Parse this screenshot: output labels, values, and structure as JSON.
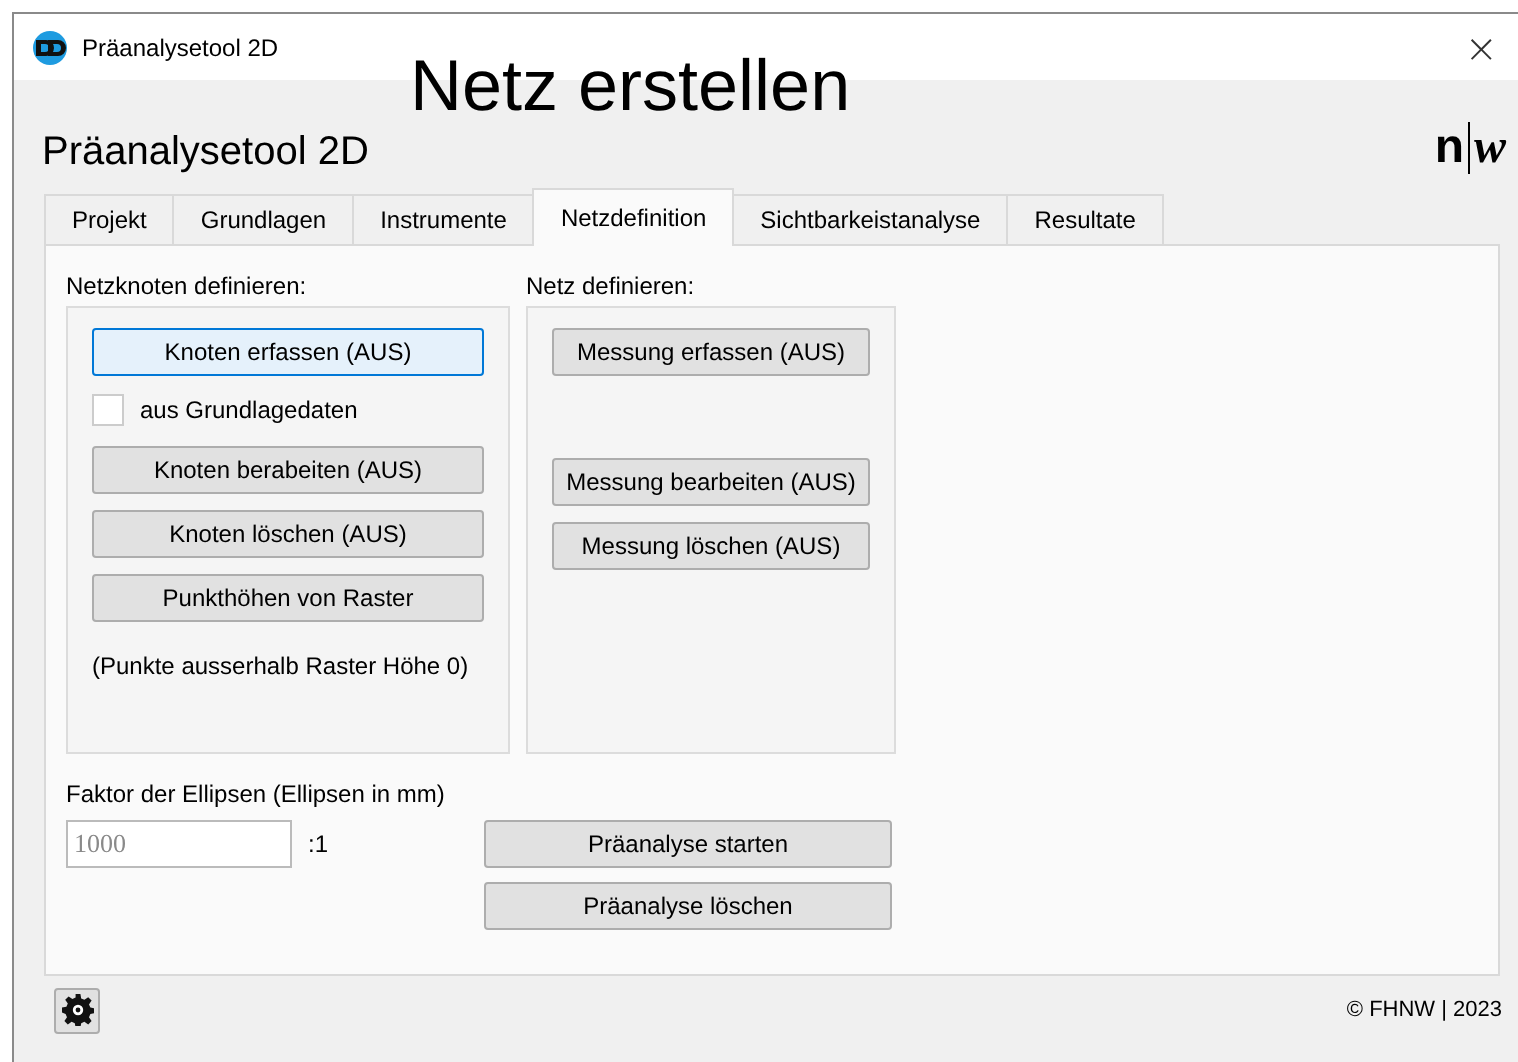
{
  "overlay_heading": "Netz erstellen",
  "window": {
    "title": "Präanalysetool 2D",
    "close": "×"
  },
  "app_title": "Präanalysetool 2D",
  "logo": {
    "left": "n",
    "right": "w"
  },
  "tabs": [
    {
      "label": "Projekt",
      "selected": false
    },
    {
      "label": "Grundlagen",
      "selected": false
    },
    {
      "label": "Instrumente",
      "selected": false
    },
    {
      "label": "Netzdefinition",
      "selected": true
    },
    {
      "label": "Sichtbarkeistanalyse",
      "selected": false
    },
    {
      "label": "Resultate",
      "selected": false
    }
  ],
  "nodes_group": {
    "label": "Netzknoten definieren:",
    "capture_button": {
      "label": "Knoten erfassen (AUS)",
      "focused": true
    },
    "checkbox": {
      "label": "aus Grundlagedaten",
      "checked": false
    },
    "buttons": [
      {
        "label": "Knoten berabeiten (AUS)",
        "focused": false
      },
      {
        "label": "Knoten löschen (AUS)",
        "focused": false
      },
      {
        "label": "Punkthöhen von Raster",
        "focused": false
      }
    ],
    "note": "(Punkte ausserhalb Raster Höhe 0)"
  },
  "net_group": {
    "label": "Netz definieren:",
    "buttons": [
      {
        "label": "Messung erfassen (AUS)",
        "focused": false
      },
      {
        "label": "Messung bearbeiten (AUS)",
        "focused": false
      },
      {
        "label": "Messung löschen (AUS)",
        "focused": false
      }
    ]
  },
  "ellipse_factor": {
    "label": "Faktor der Ellipsen (Ellipsen in mm)",
    "placeholder": "1000",
    "suffix": ":1"
  },
  "analysis_buttons": [
    {
      "label": "Präanalyse starten",
      "focused": false
    },
    {
      "label": "Präanalyse löschen",
      "focused": false
    }
  ],
  "footer": {
    "copyright": "© FHNW | 2023"
  }
}
